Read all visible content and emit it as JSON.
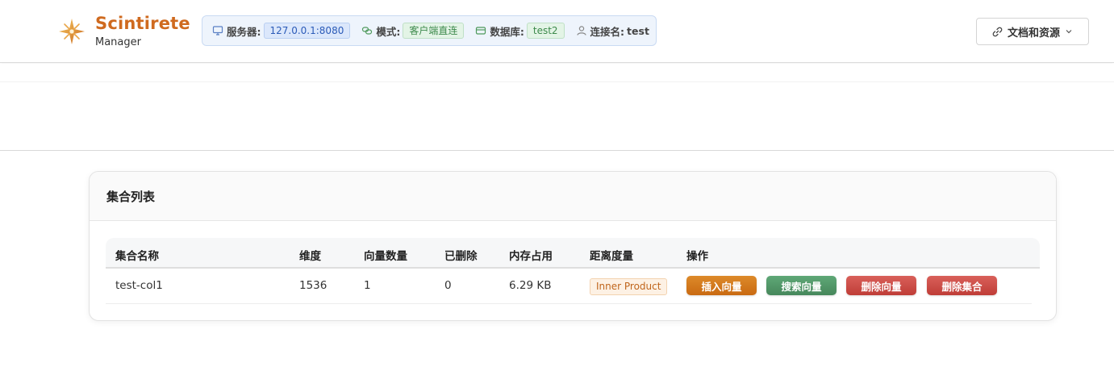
{
  "app": {
    "title": "Scintirete",
    "subtitle": "Manager"
  },
  "connection": {
    "server_label": "服务器:",
    "server_value": "127.0.0.1:8080",
    "mode_label": "模式:",
    "mode_value": "客户端直连",
    "database_label": "数据库:",
    "database_value": "test2",
    "conn_name_label": "连接名:",
    "conn_name_value": "test"
  },
  "header": {
    "docs_button_label": "文档和资源"
  },
  "collections": {
    "title": "集合列表",
    "columns": [
      "集合名称",
      "维度",
      "向量数量",
      "已删除",
      "内存占用",
      "距离度量",
      "操作"
    ],
    "rows": [
      {
        "name": "test-col1",
        "dimension": "1536",
        "vector_count": "1",
        "deleted": "0",
        "memory": "6.29 KB",
        "metric": "Inner Product",
        "actions": {
          "insert": "插入向量",
          "search": "搜索向量",
          "delete_vectors": "删除向量",
          "delete_collection": "删除集合"
        }
      }
    ]
  },
  "colors": {
    "brand": "#cf6a1f",
    "insert": "#d27a1e",
    "search": "#4f955f",
    "danger": "#cc4b45"
  }
}
